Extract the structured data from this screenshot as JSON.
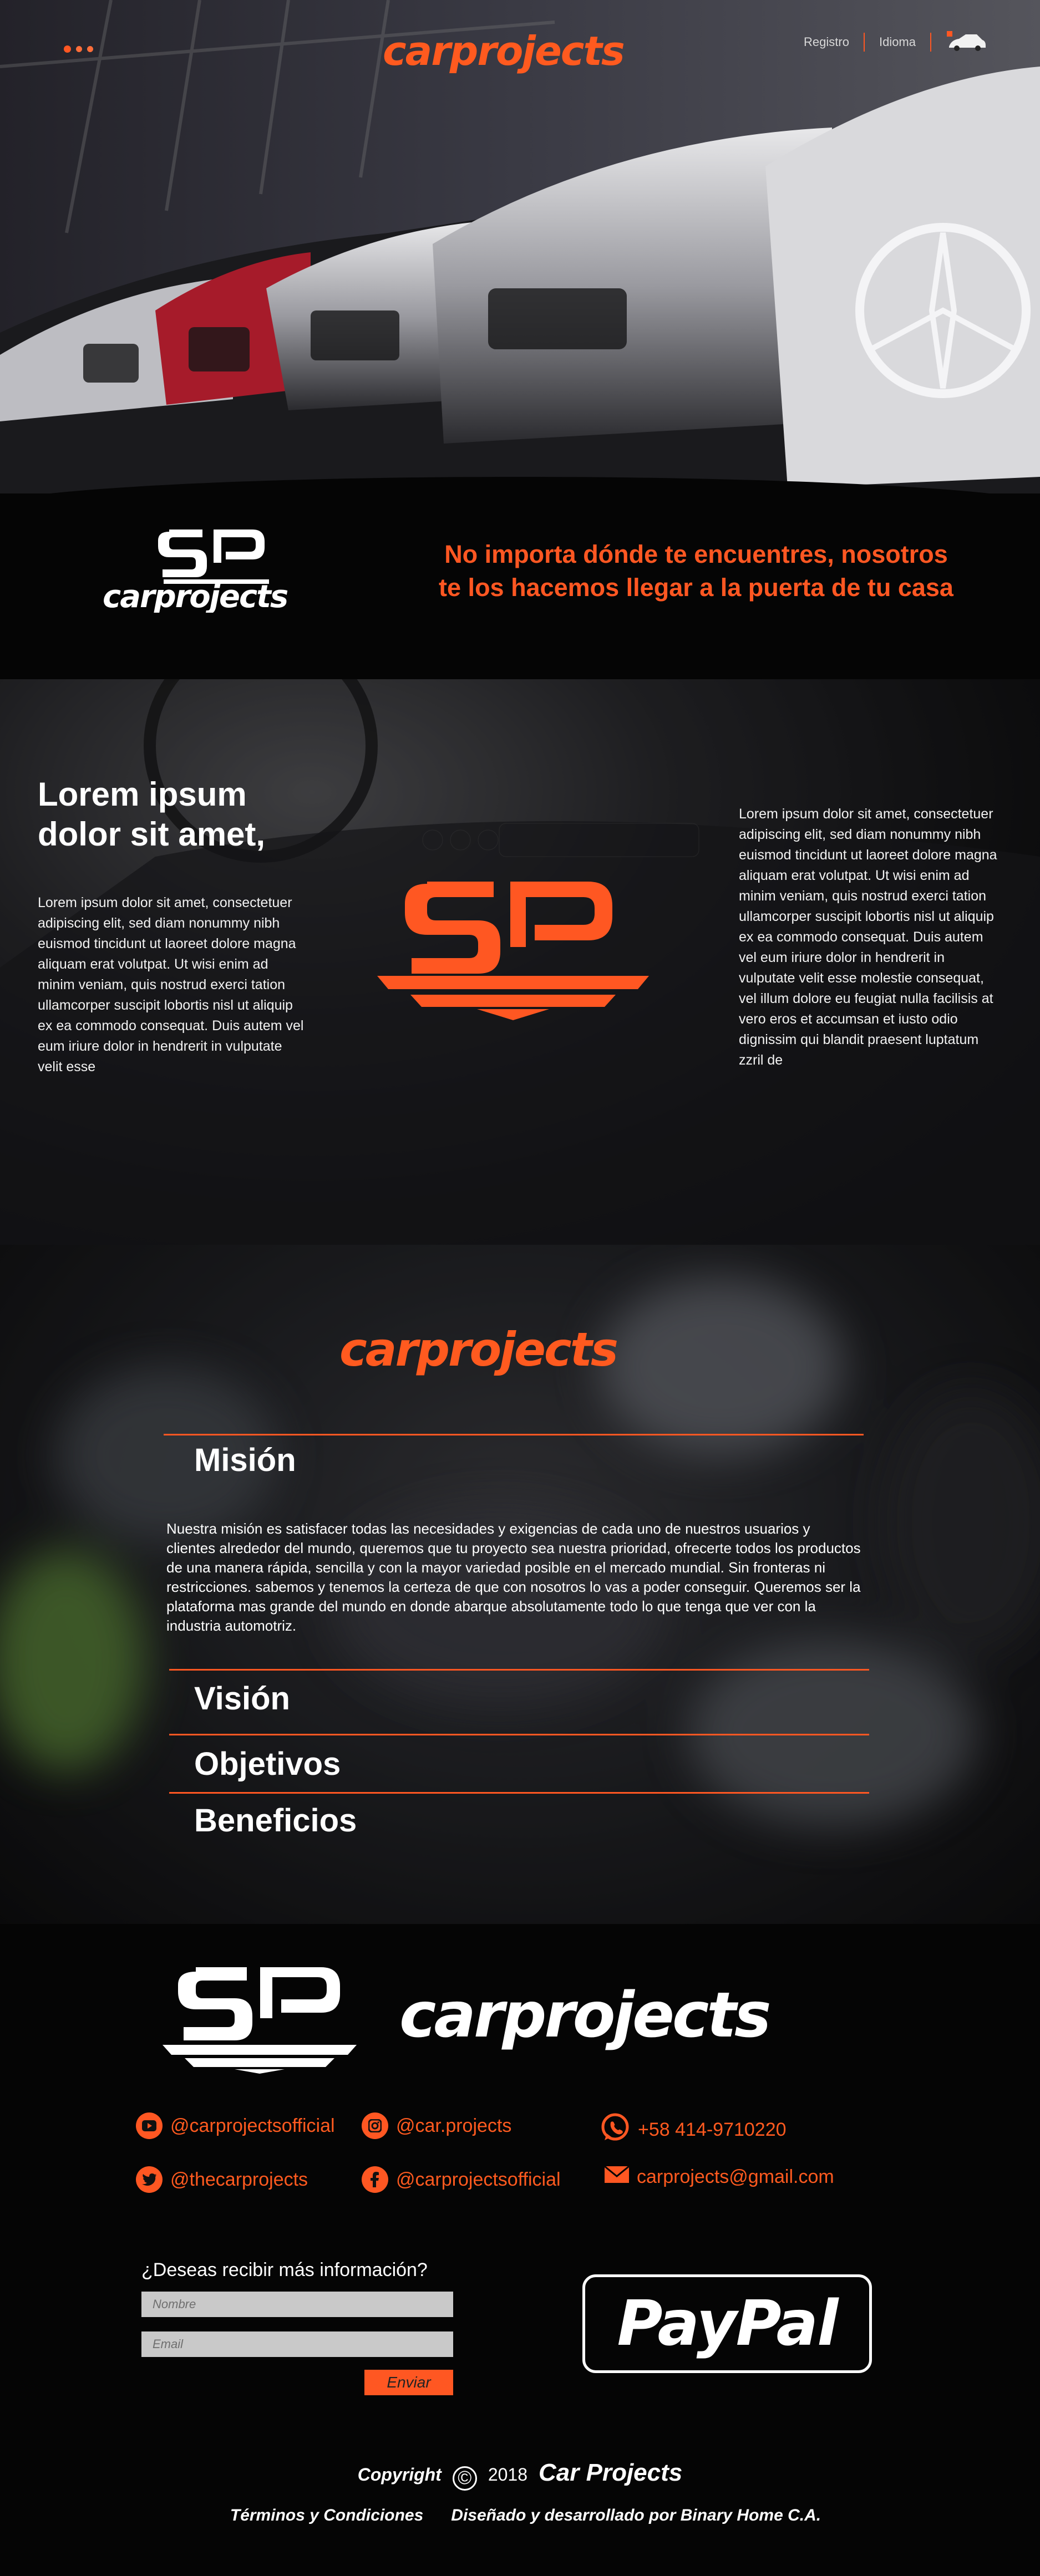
{
  "brand": {
    "name": "carprojects",
    "accent": "#ff5722"
  },
  "header": {
    "nav": [
      {
        "label": "Registro"
      },
      {
        "label": "Idioma"
      }
    ],
    "cart_icon": "car-cart-icon",
    "menu_icon": "dots-menu-icon"
  },
  "banner": {
    "tagline_line1": "No importa dónde te encuentres, nosotros",
    "tagline_line2": "te los hacemos llegar a la puerta de tu casa"
  },
  "intro": {
    "heading_line1": "Lorem ipsum",
    "heading_line2": "dolor sit amet,",
    "left_text": "Lorem ipsum dolor sit amet, consectetuer adipiscing elit, sed diam nonummy nibh euismod tincidunt ut laoreet dolore magna aliquam erat volutpat. Ut wisi enim ad minim veniam, quis nostrud exerci tation ullamcorper suscipit lobortis nisl ut aliquip ex ea commodo consequat. Duis autem vel eum iriure dolor in hendrerit in vulputate velit esse",
    "right_text": "Lorem ipsum dolor sit amet, consectetuer adipiscing elit, sed diam nonummy nibh euismod tincidunt ut laoreet dolore magna aliquam erat volutpat. Ut wisi enim ad minim veniam, quis nostrud exerci tation ullamcorper suscipit lobortis nisl ut aliquip ex ea commodo consequat. Duis autem vel eum iriure dolor in hendrerit in vulputate velit esse molestie consequat, vel illum dolore eu feugiat nulla facilisis at vero eros et accumsan et iusto odio dignissim qui blandit praesent luptatum zzril de"
  },
  "about": {
    "sections": [
      {
        "title": "Misión"
      },
      {
        "title": "Visión"
      },
      {
        "title": "Objetivos"
      },
      {
        "title": "Beneficios"
      }
    ],
    "mision_text": "Nuestra misión es satisfacer todas las necesidades y exigencias de cada uno de nuestros usuarios y clientes alrededor del mundo, queremos que tu proyecto sea nuestra prioridad, ofrecerte todos los productos de una manera rápida, sencilla y con la mayor variedad posible en el mercado mundial. Sin fronteras ni restricciones. sabemos y tenemos la certeza de que con nosotros lo vas a poder conseguir. Queremos ser la plataforma mas grande del mundo en donde abarque absolutamente todo lo que tenga que ver con la industria automotriz."
  },
  "footer": {
    "social": [
      {
        "icon": "youtube-icon",
        "label": "@carprojectsofficial"
      },
      {
        "icon": "instagram-icon",
        "label": "@car.projects"
      },
      {
        "icon": "whatsapp-icon",
        "label": "+58 414-9710220"
      },
      {
        "icon": "twitter-icon",
        "label": "@thecarprojects"
      },
      {
        "icon": "facebook-icon",
        "label": "@carprojectsofficial"
      },
      {
        "icon": "mail-icon",
        "label": "carprojects@gmail.com"
      }
    ],
    "form": {
      "label": "¿Deseas recibir más información?",
      "name_placeholder": "Nombre",
      "email_placeholder": "Email",
      "submit": "Enviar"
    },
    "paypal": "PayPal",
    "copyright": {
      "prefix": "Copyright",
      "symbol": "©",
      "year": "2018",
      "name": "Car Projects"
    },
    "links": [
      {
        "label": "Términos y Condiciones"
      },
      {
        "label": "Diseñado y desarrollado por Binary Home C.A."
      }
    ]
  }
}
